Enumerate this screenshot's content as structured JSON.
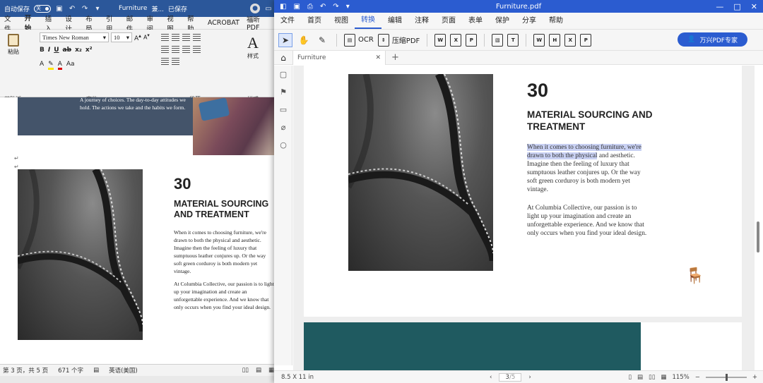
{
  "word": {
    "autosave_label": "自动保存",
    "autosave_state": "关",
    "doc_title": "Furniture",
    "doc_title_suffix": "兼...",
    "saved_state": "已保存",
    "tabs": [
      "文件",
      "开始",
      "插入",
      "设计",
      "布局",
      "引用",
      "邮件",
      "审阅",
      "视图",
      "帮助",
      "ACROBAT",
      "福昕PDF"
    ],
    "active_tab": "开始",
    "ribbon": {
      "paste_label": "粘贴",
      "font_name": "Times New Roman",
      "font_size": "10",
      "style_label": "样式",
      "group_clipboard": "剪贴板",
      "group_font": "字体",
      "group_paragraph": "段落",
      "group_style": "样式"
    },
    "page": {
      "intro_text": "A journey of choices. The day-to-day attitudes we hold. The actions we take and the habits we form.",
      "number": "30",
      "heading": "MATERIAL SOURCING AND TREATMENT",
      "para1": "When it comes to choosing furniture, we're drawn to both the physical and aesthetic. Imagine then the feeling of luxury that sumptuous leather conjures up. Or the way soft green corduroy is both modern yet vintage.",
      "para2": "At Columbia Collective, our passion is to light up your imagination and create an unforgettable experience. And we know that only occurs when you find your ideal design."
    },
    "status": {
      "page_info": "第 3 页，共 5 页",
      "word_count": "671 个字",
      "language": "英语(美国)"
    }
  },
  "pdf": {
    "window_title": "Furniture.pdf",
    "menu": [
      "文件",
      "首页",
      "视图",
      "转换",
      "编辑",
      "注释",
      "页面",
      "表单",
      "保护",
      "分享",
      "帮助"
    ],
    "active_menu": "转换",
    "tools": {
      "ocr_label": "OCR",
      "compress_label": "压缩PDF",
      "expert_label": "万兴PDF专家"
    },
    "tab_title": "Furniture",
    "page": {
      "number": "30",
      "heading": "MATERIAL SOURCING AND TREATMENT",
      "para1_highlight": "When it comes to choosing furniture, we're drawn to both the physical",
      "para1_rest": " and aesthetic. Imagine then the feeling of luxury that sumptuous leather conjures up. Or the way soft green corduroy is both modern yet vintage.",
      "para2": "At Columbia Collective, our passion is to light up your imagination and create an unforgettable experience. And we know that only occurs when you find your ideal design."
    },
    "status": {
      "page_size": "8.5 X 11 in",
      "current_page": "3",
      "total_pages": "/5",
      "zoom": "115%"
    }
  },
  "colors": {
    "word_accent": "#2b579a",
    "pdf_accent": "#2b5cd0",
    "highlight": "#c9d1f3",
    "teal_block": "#1f5a60",
    "intro_block": "#44546a"
  }
}
